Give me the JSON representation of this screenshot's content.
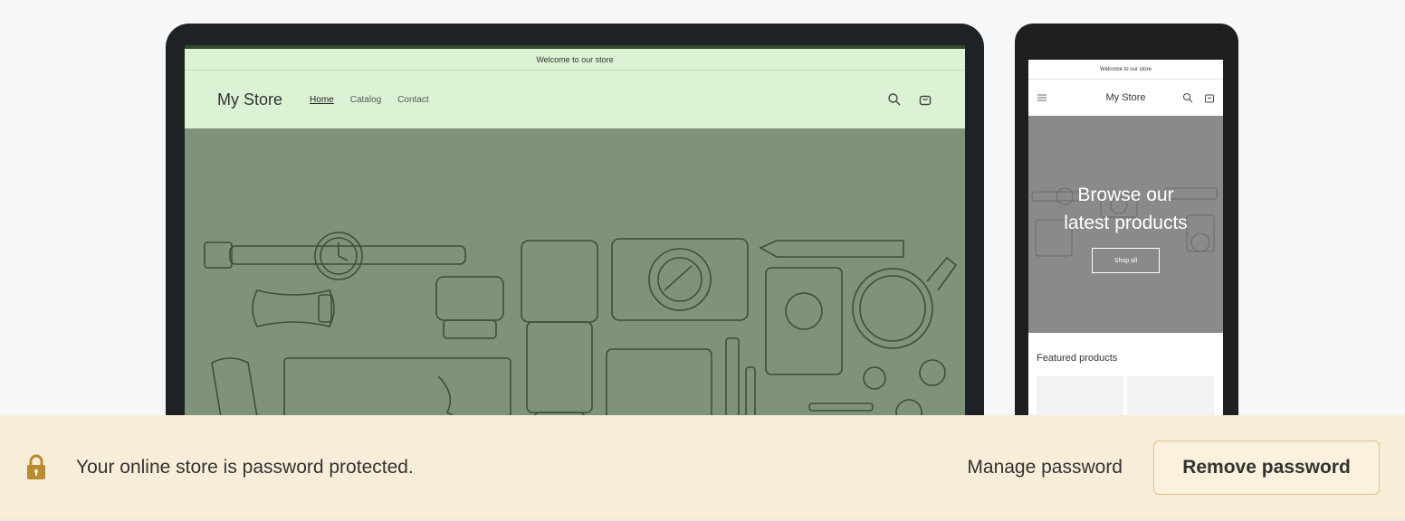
{
  "desktop_preview": {
    "announcement": "Welcome to our store",
    "logo": "My Store",
    "nav": [
      "Home",
      "Catalog",
      "Contact"
    ],
    "icons": [
      "search-icon",
      "cart-icon"
    ],
    "hero_bg": "#7f9379",
    "header_bg": "#dcf2d5"
  },
  "mobile_preview": {
    "announcement": "Welcome to our store",
    "logo": "My Store",
    "hero_title_line1": "Browse our",
    "hero_title_line2": "latest products",
    "hero_button": "Shop all",
    "featured_heading": "Featured products",
    "icons": [
      "menu-icon",
      "search-icon",
      "cart-icon"
    ]
  },
  "banner": {
    "message": "Your online store is password protected.",
    "manage_label": "Manage password",
    "remove_label": "Remove password",
    "bg": "#f8edd8",
    "lock_color": "#b98a2f"
  }
}
